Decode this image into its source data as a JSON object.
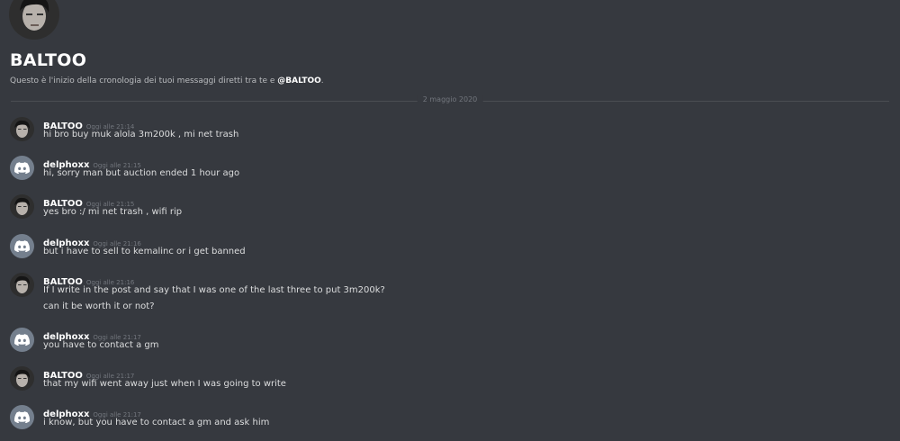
{
  "header": {
    "username": "BALTOO",
    "intro_prefix": "Questo è l'inizio della cronologia dei tuoi messaggi diretti tra te e ",
    "intro_mention": "@BALTOO",
    "intro_suffix": "."
  },
  "divider": {
    "date": "2 maggio 2020"
  },
  "messages": [
    {
      "author": "BALTOO",
      "avatar": "photo-avatar",
      "time": "Oggi alle 21:14",
      "lines": [
        "hi bro buy muk alola 3m200k , mi net trash"
      ]
    },
    {
      "author": "delphoxx",
      "avatar": "discord-logo-avatar",
      "time": "Oggi alle 21:15",
      "lines": [
        "hi, sorry man but auction ended 1 hour ago"
      ]
    },
    {
      "author": "BALTOO",
      "avatar": "photo-avatar",
      "time": "Oggi alle 21:15",
      "lines": [
        "yes bro :/ mi net trash , wifi rip"
      ]
    },
    {
      "author": "delphoxx",
      "avatar": "discord-logo-avatar",
      "time": "Oggi alle 21:16",
      "lines": [
        "but i have to sell to kemalinc or i get banned"
      ]
    },
    {
      "author": "BALTOO",
      "avatar": "photo-avatar",
      "time": "Oggi alle 21:16",
      "lines": [
        "If I write in the post and say that I was one of the last three to put 3m200k?",
        "can it be worth it or not?"
      ]
    },
    {
      "author": "delphoxx",
      "avatar": "discord-logo-avatar",
      "time": "Oggi alle 21:17",
      "lines": [
        "you have to contact a gm"
      ]
    },
    {
      "author": "BALTOO",
      "avatar": "photo-avatar",
      "time": "Oggi alle 21:17",
      "lines": [
        "that my wifi went away just when I was going to write"
      ]
    },
    {
      "author": "delphoxx",
      "avatar": "discord-logo-avatar",
      "time": "Oggi alle 21:17",
      "lines": [
        "i know, but you have to contact a gm and ask him"
      ]
    }
  ]
}
